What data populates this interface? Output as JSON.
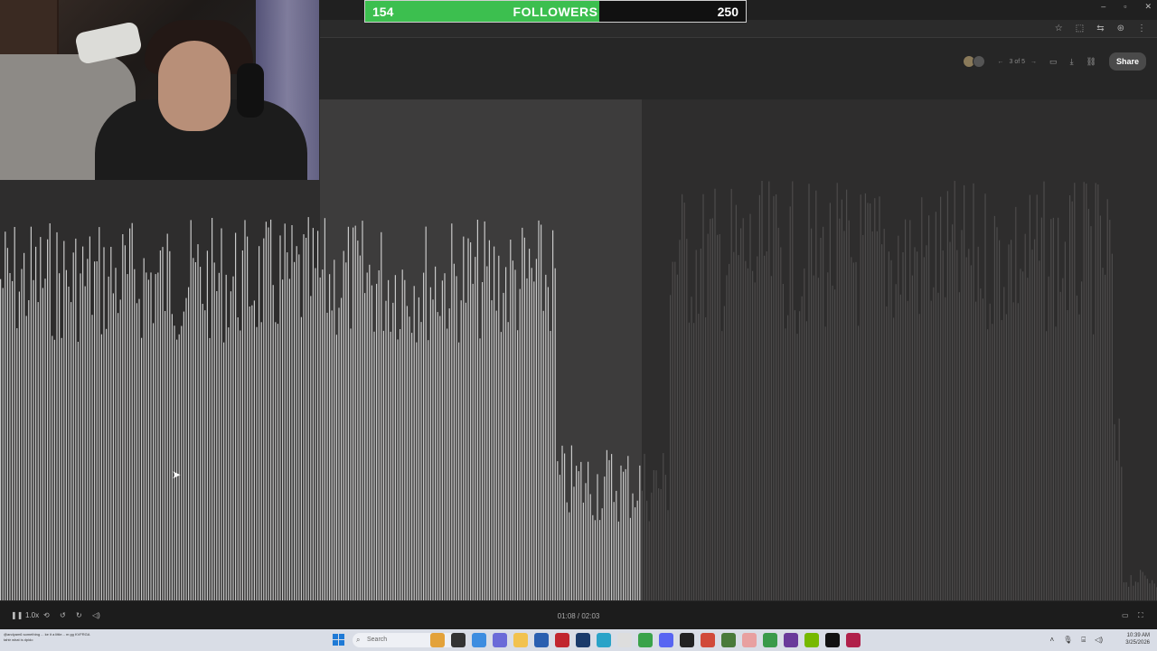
{
  "browser": {
    "win_controls": [
      "–",
      "▫",
      "✕"
    ],
    "addr_icons": [
      "☆",
      "⬚",
      "⇆",
      "⊛",
      "⋮"
    ]
  },
  "header": {
    "pager_label": "3 of 5",
    "share_label": "Share"
  },
  "follower_goal": {
    "current": "154",
    "label": "FOLLOWERS",
    "goal": "250",
    "progress_fraction": 0.616,
    "fill_color": "#3cbf4f"
  },
  "player": {
    "speed": "1.0x",
    "time": "01:08 / 02:03",
    "play_state_icon": "pause-icon",
    "playhead_fraction": 0.553
  },
  "waveform": {
    "played_color": "#c9c9c9",
    "unplayed_color": "#4c4b4b"
  },
  "taskbar": {
    "search_placeholder": "Search",
    "time": "10:39 AM",
    "date": "3/25/2026",
    "chat_ticker_1": "@andyam6  something ... ke it a little... m gg  KVFRGA",
    "chat_ticker_2": "tahtr  what is dpido"
  }
}
